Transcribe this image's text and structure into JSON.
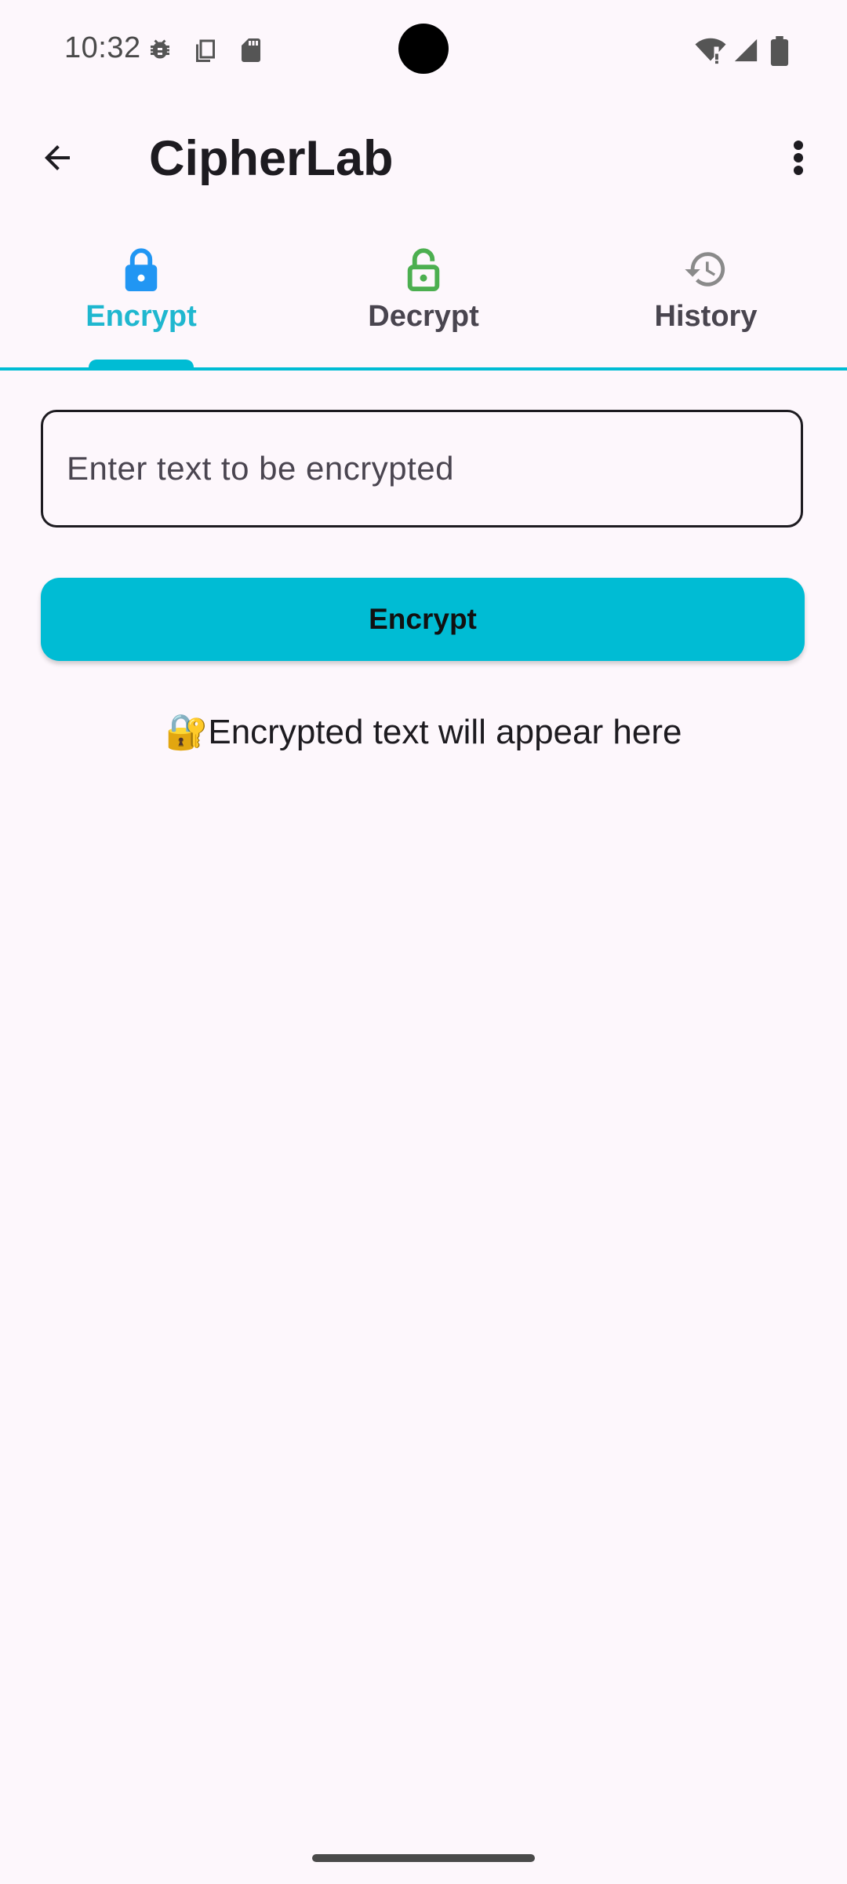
{
  "status_bar": {
    "time": "10:32",
    "left_icons": [
      "bug-icon",
      "copy-icon",
      "sd-card-icon"
    ],
    "right_icons": [
      "wifi-alert-icon",
      "cell-signal-icon",
      "battery-icon"
    ]
  },
  "app_bar": {
    "title": "CipherLab",
    "back_icon": "arrow-back-icon",
    "more_icon": "more-vert-icon"
  },
  "tabs": [
    {
      "label": "Encrypt",
      "icon": "lock-closed-icon",
      "icon_color": "#2196f3",
      "active": true
    },
    {
      "label": "Decrypt",
      "icon": "lock-open-icon",
      "icon_color": "#4caf50",
      "active": false
    },
    {
      "label": "History",
      "icon": "history-icon",
      "icon_color": "#8a8a8a",
      "active": false
    }
  ],
  "input": {
    "placeholder": "Enter text to be encrypted",
    "value": ""
  },
  "encrypt_button": {
    "label": "Encrypt"
  },
  "result": {
    "emoji": "🔐",
    "text": "Encrypted text will appear here"
  },
  "colors": {
    "accent": "#00bcd4",
    "active_tab_text": "#1fb7cf",
    "background": "#fdf7fc"
  }
}
